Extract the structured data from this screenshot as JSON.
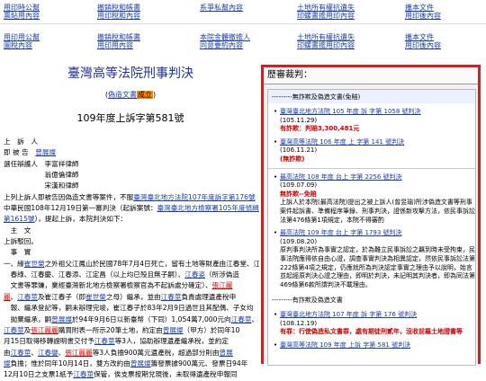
{
  "top_links": [
    {
      "label": "用印時公幫",
      "row": 1,
      "col": 1
    },
    {
      "label": "撤銷稅和帳書",
      "row": 1,
      "col": 2
    },
    {
      "label": "系爭私幫內容",
      "row": 1,
      "col": 3
    },
    {
      "label": "土地所有權抗遺失",
      "row": 1,
      "col": 4
    },
    {
      "label": "攜本文件",
      "row": 1,
      "col": 5
    },
    {
      "label": "票貼用內容",
      "row": 2,
      "col": 1
    },
    {
      "label": "用印稅和內容",
      "row": 2,
      "col": 2
    },
    {
      "label": "印螺書擔用印內容",
      "row": 2,
      "col": 4
    },
    {
      "label": "用印後內容",
      "row": 2,
      "col": 5
    },
    {
      "label": "用印用公幫",
      "row": 3,
      "col": 1
    },
    {
      "label": "撤銷稅和帳書",
      "row": 3,
      "col": 2
    },
    {
      "label": "本院金體撤擔人",
      "row": 3,
      "col": 3
    },
    {
      "label": "土地所有權抗遺失",
      "row": 3,
      "col": 4
    },
    {
      "label": "攜本文件",
      "row": 3,
      "col": 5
    },
    {
      "label": "圖稅內容",
      "row": 4,
      "col": 1
    },
    {
      "label": "用印用內容",
      "row": 4,
      "col": 2
    },
    {
      "label": "同意要約內容",
      "row": 4,
      "col": 3
    },
    {
      "label": "印螺書擔用印內容",
      "row": 4,
      "col": 4
    },
    {
      "label": "用印後內容",
      "row": 4,
      "col": 5
    }
  ],
  "judgment": {
    "court_title": "臺灣高等法院刑事判決",
    "status_open": "(",
    "status_query": "偽造文書",
    "status_result": "成立",
    "status_close": ")",
    "case_number": "109年度上訴字第581號",
    "lines": [
      [
        {
          "t": "上　訴　人"
        }
      ],
      [
        {
          "t": "即 被 告　"
        },
        {
          "t": "曾展燦",
          "c": "blue"
        }
      ],
      [
        {
          "t": ""
        }
      ],
      [
        {
          "t": "選任辯護人　李富祥律師"
        }
      ],
      [
        {
          "t": "　　　　　　翁億倫律師"
        }
      ],
      [
        {
          "t": "　　　　　　宋漢和律師"
        }
      ],
      [
        {
          "t": "上列上訴人即被告因偽造文書等案件，不服"
        },
        {
          "t": "臺灣臺北地方法院107年度訴字第176號",
          "c": "blue"
        }
      ],
      [
        {
          "t": "中華民國108年12月19日第一審判決（起訴案號："
        },
        {
          "t": "臺灣臺北地方檢察署105年度偵緝字",
          "c": "blue"
        }
      ],
      [
        {
          "t": "第1615號",
          "c": "blue"
        },
        {
          "t": "），提起上訴，本院判決如下："
        }
      ],
      [
        {
          "t": "　主　文"
        }
      ],
      [
        {
          "t": "上訴駁回。"
        }
      ],
      [
        {
          "t": "　事　實"
        }
      ],
      [
        {
          "t": "一、緣"
        },
        {
          "t": "崔世榮",
          "c": "blue"
        },
        {
          "t": "之外祖父江鳳山於民國78年7月4日死亡，留有土地等財產由江春堂、江"
        }
      ],
      [
        {
          "t": "　春綠、江春慶、江春添、江定昌（以上均已殁且無子嗣）、"
        },
        {
          "t": "江春姿",
          "c": "blue"
        },
        {
          "t": "（所涉偽造"
        }
      ],
      [
        {
          "t": "　文書等罪嫌，業經臺灣新北地方檢察署檢察官為不起訴處分確定）、"
        },
        {
          "t": "張江麗",
          "c": "red"
        }
      ],
      [
        {
          "t": "麗",
          "c": "red"
        },
        {
          "t": "、"
        },
        {
          "t": "江春莖",
          "c": "blue"
        },
        {
          "t": "及崔江春子（即"
        },
        {
          "t": "崔世榮",
          "c": "blue"
        },
        {
          "t": "之母）繼承，並由"
        },
        {
          "t": "江春莖",
          "c": "blue"
        },
        {
          "t": "負責處理遺產稅申"
        }
      ],
      [
        {
          "t": "　報、繼承登記等，嗣未辦理完竣，崔江春子於83年2月9日過世且其配偶、子女均"
        }
      ],
      [
        {
          "t": "　拋棄繼承，嗣"
        },
        {
          "t": "曾展燦",
          "c": "blue"
        },
        {
          "t": "於94年9月6日以新臺幣（下同）1,054萬7,000元向"
        },
        {
          "t": "江春莖",
          "c": "blue"
        },
        {
          "t": "、"
        }
      ],
      [
        {
          "t": "江春莖",
          "c": "blue"
        },
        {
          "t": "及"
        },
        {
          "t": "張江麗麗",
          "c": "red"
        },
        {
          "t": "購買附表一所示20筆土地，約定由"
        },
        {
          "t": "曾展燦",
          "c": "blue"
        },
        {
          "t": "（甲方）於同年10"
        }
      ],
      [
        {
          "t": "月15日取得移轉證明書交付予"
        },
        {
          "t": "江春莖",
          "c": "blue"
        },
        {
          "t": "等3人，協助辦理遺產繼承稅，並約定"
        }
      ],
      [
        {
          "t": "由"
        },
        {
          "t": "江春莖",
          "c": "blue"
        },
        {
          "t": "、"
        },
        {
          "t": "江春鑾",
          "c": "blue"
        },
        {
          "t": "、"
        },
        {
          "t": "張江麗麗",
          "c": "red"
        },
        {
          "t": "等3人負擔900萬元遺產稅，超過部分則由"
        },
        {
          "t": "曾展",
          "c": "blue"
        }
      ],
      [
        {
          "t": "燦",
          "c": "blue"
        },
        {
          "t": "負擔；惟於同年10月14日，雙方改約由"
        },
        {
          "t": "曾展燦",
          "c": "blue"
        },
        {
          "t": "籌發票據900萬元、發票日94年"
        }
      ],
      [
        {
          "t": "12月10日之支票1紙予"
        },
        {
          "t": "江春莖",
          "c": "blue"
        },
        {
          "t": "保管，俟支票按期兌現後，未取得遺產稅申報同"
        }
      ]
    ]
  },
  "panel": {
    "title": "歷審裁判：",
    "sections": [
      {
        "header": "---------無詐欺及偽造文書(免賠)",
        "items": [
          {
            "title": "臺灣臺北地方法院 105 年度 訴 字第 1058 號判決",
            "date": "(105.11.29)",
            "result": "有詐欺：判賠3,300,481元",
            "result_color": "red"
          },
          {
            "title": "臺灣高等法院 106 年度 上 字第 141 號判決",
            "date": "(106.11.21)",
            "result": "(無詐欺)",
            "result_color": "red"
          }
        ]
      },
      {
        "header": "",
        "items": [
          {
            "title": "最高法院 108 年度 台上 字第 2256 號判決",
            "date": "(109.07.09)",
            "result": "無詐欺--免賠",
            "result_color": "red",
            "text": "上訴人於本院(最高法院)提出之被上訴人(曾昱瑜)所涉偽造文書等刑事案件起訴書、準備程序筆錄、刑事判決，證係新攻擊方法，依民事訴訟法第476條第1項規定，本院不得審酌"
          },
          {
            "title": "最高法院 109 年度 台上 字第 1793 號判決",
            "date": "(109.08.20)",
            "text": "原判事判決所為事實之認定，於為難立民事訴訟之羈到時未受拘束，民事法院應得依自由心證，調查事實判決為相異認定，然依民事訴訟法第222條第4項之規定，仍應就所為判決認定事實之理由予以說明，始言並起經原判決心證之理由，即明於判決，未記明其判決者，即為同法第469條第6款所謂判決不載理由。"
          }
        ]
      },
      {
        "header": "---------有詐欺及偽造文書",
        "items": [
          {
            "title": "臺灣臺北地方法院 107 年度 訴 字第 176 號判決",
            "date": "(108.12.19)",
            "result": "有罪：行使偽造私文書罪，處有期徒刑貳年，沒收前羅土地證書等",
            "result_color": "red"
          },
          {
            "title": "臺灣高等法院 109 年度 上訴 字第 581 號判決",
            "date": "",
            "result": "",
            "result_color": "red"
          }
        ]
      }
    ]
  }
}
